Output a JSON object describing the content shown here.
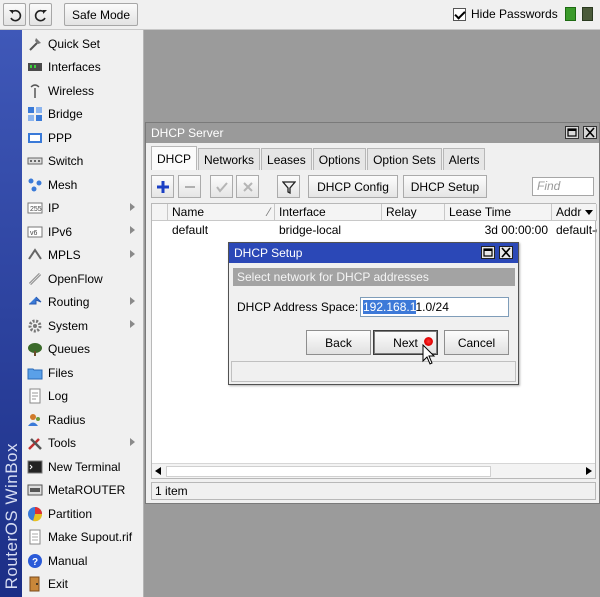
{
  "topbar": {
    "safe_mode_label": "Safe Mode",
    "hide_passwords_label": "Hide Passwords",
    "hide_passwords_checked": true
  },
  "brand": "RouterOS WinBox",
  "sidebar": {
    "items": [
      {
        "label": "Quick Set",
        "icon": "quick-set-icon",
        "submenu": false
      },
      {
        "label": "Interfaces",
        "icon": "interfaces-icon",
        "submenu": false
      },
      {
        "label": "Wireless",
        "icon": "wireless-icon",
        "submenu": false
      },
      {
        "label": "Bridge",
        "icon": "bridge-icon",
        "submenu": false
      },
      {
        "label": "PPP",
        "icon": "ppp-icon",
        "submenu": false
      },
      {
        "label": "Switch",
        "icon": "switch-icon",
        "submenu": false
      },
      {
        "label": "Mesh",
        "icon": "mesh-icon",
        "submenu": false
      },
      {
        "label": "IP",
        "icon": "ip-icon",
        "submenu": true
      },
      {
        "label": "IPv6",
        "icon": "ipv6-icon",
        "submenu": true
      },
      {
        "label": "MPLS",
        "icon": "mpls-icon",
        "submenu": true
      },
      {
        "label": "OpenFlow",
        "icon": "openflow-icon",
        "submenu": false
      },
      {
        "label": "Routing",
        "icon": "routing-icon",
        "submenu": true
      },
      {
        "label": "System",
        "icon": "system-icon",
        "submenu": true
      },
      {
        "label": "Queues",
        "icon": "queues-icon",
        "submenu": false
      },
      {
        "label": "Files",
        "icon": "files-icon",
        "submenu": false
      },
      {
        "label": "Log",
        "icon": "log-icon",
        "submenu": false
      },
      {
        "label": "Radius",
        "icon": "radius-icon",
        "submenu": false
      },
      {
        "label": "Tools",
        "icon": "tools-icon",
        "submenu": true
      },
      {
        "label": "New Terminal",
        "icon": "terminal-icon",
        "submenu": false
      },
      {
        "label": "MetaROUTER",
        "icon": "metarouter-icon",
        "submenu": false
      },
      {
        "label": "Partition",
        "icon": "partition-icon",
        "submenu": false
      },
      {
        "label": "Make Supout.rif",
        "icon": "supout-icon",
        "submenu": false
      },
      {
        "label": "Manual",
        "icon": "help-icon",
        "submenu": false
      },
      {
        "label": "Exit",
        "icon": "exit-icon",
        "submenu": false
      }
    ]
  },
  "dhcp_window": {
    "title": "DHCP Server",
    "tabs": [
      "DHCP",
      "Networks",
      "Leases",
      "Options",
      "Option Sets",
      "Alerts"
    ],
    "active_tab": "DHCP",
    "toolbar": {
      "dhcp_config_label": "DHCP Config",
      "dhcp_setup_label": "DHCP Setup",
      "find_placeholder": "Find"
    },
    "columns": [
      "Name",
      "Interface",
      "Relay",
      "Lease Time",
      "Addr"
    ],
    "rows": [
      {
        "name": "default",
        "interface": "bridge-local",
        "relay": "",
        "lease_time": "3d 00:00:00",
        "addr": "default-c"
      }
    ],
    "status_text": "1 item"
  },
  "setup_dialog": {
    "title": "DHCP Setup",
    "subtitle": "Select network for DHCP addresses",
    "field_label": "DHCP Address Space:",
    "field_value_selected": "192.168.1",
    "field_value_rest": "1.0/24",
    "back_label": "Back",
    "next_label": "Next",
    "cancel_label": "Cancel"
  },
  "colors": {
    "brand_strip": "#2b40a0",
    "dialog_title": "#2b48b7",
    "selection": "#3d79d8"
  }
}
